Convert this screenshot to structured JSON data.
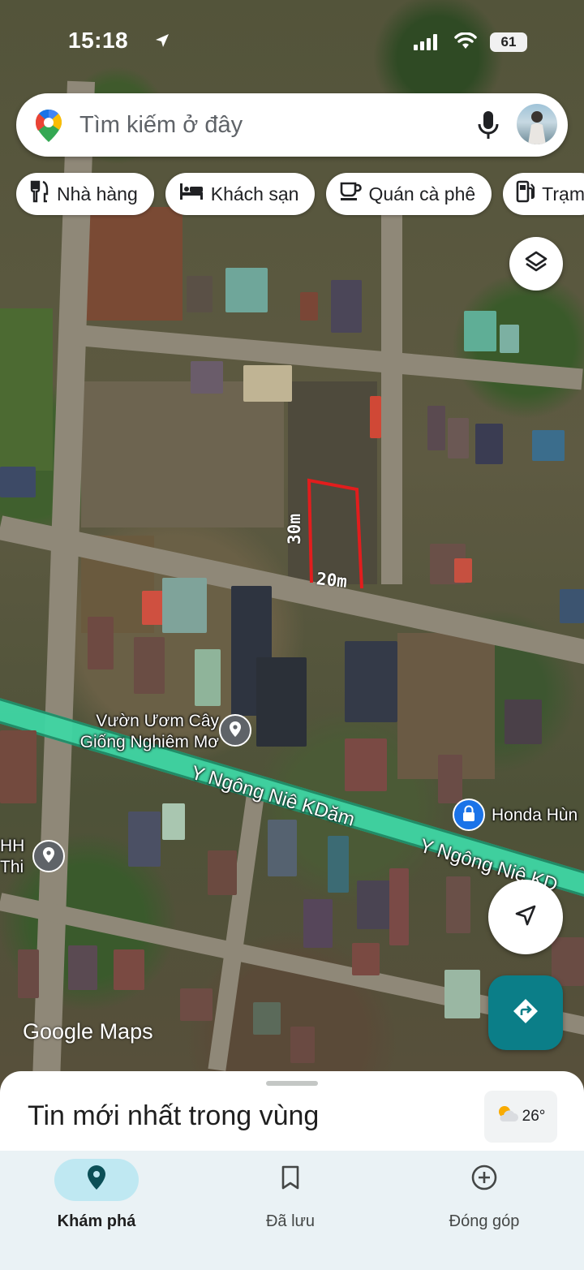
{
  "status_bar": {
    "time": "15:18",
    "battery": "61"
  },
  "search": {
    "placeholder": "Tìm kiếm ở đây"
  },
  "chips": [
    {
      "label": "Nhà hàng",
      "icon": "restaurant-icon"
    },
    {
      "label": "Khách sạn",
      "icon": "hotel-icon"
    },
    {
      "label": "Quán cà phê",
      "icon": "cafe-icon"
    },
    {
      "label": "Trạm",
      "icon": "gas-station-icon"
    }
  ],
  "map": {
    "places": [
      {
        "name": "Vườn Ươm Cây\nGiống Nghiêm Mơ"
      },
      {
        "name": "Honda Hùn"
      },
      {
        "name": "HH\nThi"
      }
    ],
    "streets": [
      "Y Ngông Niê KDăm",
      "Y Ngông Niê KD"
    ],
    "plot_measurements": {
      "side": "30m",
      "front": "20m"
    },
    "plot_outline_color": "#e21d1d",
    "highlighted_road_color": "#3fd6a4",
    "attribution": "Google Maps"
  },
  "sheet": {
    "title": "Tin mới nhất trong vùng",
    "weather": "26°"
  },
  "nav": [
    {
      "label": "Khám phá",
      "icon": "explore-pin-icon",
      "active": true
    },
    {
      "label": "Đã lưu",
      "icon": "bookmark-icon",
      "active": false
    },
    {
      "label": "Đóng góp",
      "icon": "add-circle-icon",
      "active": false
    }
  ],
  "colors": {
    "accent": "#0b7e88",
    "nav_active_bg": "#bfe8f2",
    "nav_bg": "#eaf2f5"
  }
}
